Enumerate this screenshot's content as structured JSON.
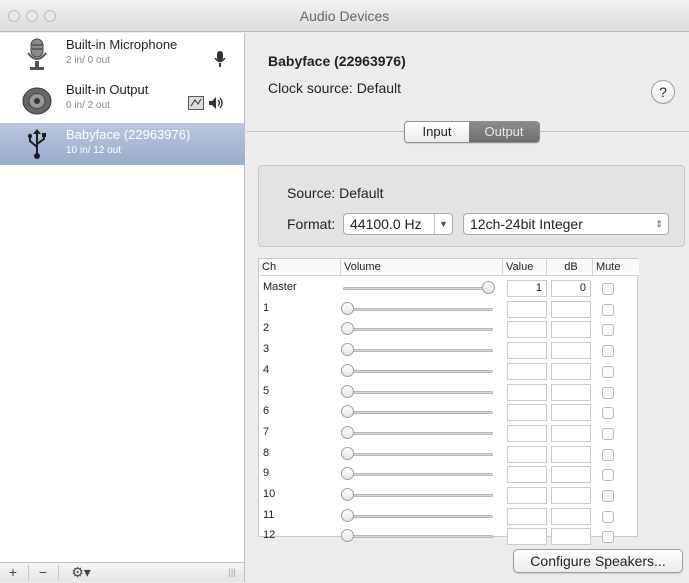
{
  "window": {
    "title": "Audio Devices"
  },
  "devices": [
    {
      "name": "Built-in Microphone",
      "io": "2 in/ 0 out",
      "icon": "microphone-icon"
    },
    {
      "name": "Built-in Output",
      "io": "0 in/ 2 out",
      "icon": "speaker-icon"
    },
    {
      "name": "Babyface (22963976)",
      "io": "10 in/ 12 out",
      "icon": "usb-icon",
      "selected": true
    }
  ],
  "bottombar": {
    "add_label": "+",
    "remove_label": "−",
    "gear_label": "⚙▾",
    "resize_label": "|||"
  },
  "detail": {
    "device_title": "Babyface (22963976)",
    "clock_source": "Clock source: Default",
    "help_label": "?",
    "tabs": [
      {
        "label": "Input",
        "active": false
      },
      {
        "label": "Output",
        "active": true
      }
    ],
    "source_label": "Source:",
    "source_value": "Default",
    "format_label": "Format:",
    "sample_rate": "44100.0 Hz",
    "bit_format": "12ch-24bit Integer",
    "configure_label": "Configure Speakers..."
  },
  "table": {
    "headers": {
      "ch": "Ch",
      "volume": "Volume",
      "value": "Value",
      "db": "dB",
      "mute": "Mute"
    },
    "rows": [
      {
        "ch": "Master",
        "volume": 1.0,
        "value": "1",
        "db": "0"
      },
      {
        "ch": "1",
        "volume": 0,
        "value": "",
        "db": ""
      },
      {
        "ch": "2",
        "volume": 0,
        "value": "",
        "db": ""
      },
      {
        "ch": "3",
        "volume": 0,
        "value": "",
        "db": ""
      },
      {
        "ch": "4",
        "volume": 0,
        "value": "",
        "db": ""
      },
      {
        "ch": "5",
        "volume": 0,
        "value": "",
        "db": ""
      },
      {
        "ch": "6",
        "volume": 0,
        "value": "",
        "db": ""
      },
      {
        "ch": "7",
        "volume": 0,
        "value": "",
        "db": ""
      },
      {
        "ch": "8",
        "volume": 0,
        "value": "",
        "db": ""
      },
      {
        "ch": "9",
        "volume": 0,
        "value": "",
        "db": ""
      },
      {
        "ch": "10",
        "volume": 0,
        "value": "",
        "db": ""
      },
      {
        "ch": "11",
        "volume": 0,
        "value": "",
        "db": ""
      },
      {
        "ch": "12",
        "volume": 0,
        "value": "",
        "db": ""
      }
    ]
  },
  "colors": {
    "selection": "#a7b6d3",
    "segment_active": "#7a7a7a"
  }
}
